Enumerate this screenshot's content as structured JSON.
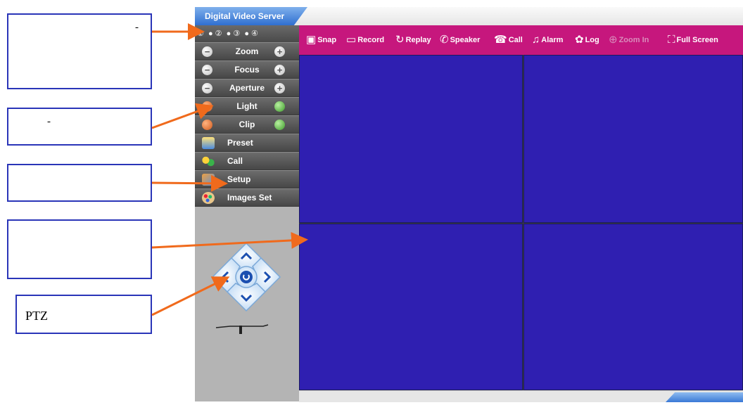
{
  "app": {
    "title": "Digital Video Server"
  },
  "panel": {
    "channels": "①  ● ②  ● ③  ● ④",
    "zoom_label": "Zoom",
    "focus_label": "Focus",
    "aperture_label": "Aperture",
    "light_label": "Light",
    "clip_label": "Clip",
    "preset_label": "Preset",
    "call_label": "Call",
    "setup_label": "Setup",
    "images_label": "Images Set"
  },
  "toolbar": {
    "snap": "Snap",
    "record": "Record",
    "replay": "Replay",
    "speaker": "Speaker",
    "call": "Call",
    "alarm": "Alarm",
    "log": "Log",
    "zoom_in": "Zoom In",
    "full_screen": "Full Screen"
  },
  "callouts": {
    "c1_text": "-",
    "c2_text": "-",
    "c5_text": "PTZ"
  },
  "colors": {
    "video_bg": "#2f1fb1",
    "toolbar_bg": "#c6177d",
    "panel_bg": "#b4b4b4",
    "callout_border": "#2a35b8",
    "arrow": "#f06a1c"
  },
  "icons": {
    "snap": "camera-icon",
    "record": "clapperboard-icon",
    "replay": "replay-icon",
    "speaker": "phone-icon",
    "call": "call-icon",
    "alarm": "bell-icon",
    "log": "log-icon",
    "zoom_in": "magnifier-plus-icon",
    "full_screen": "fullscreen-icon"
  }
}
